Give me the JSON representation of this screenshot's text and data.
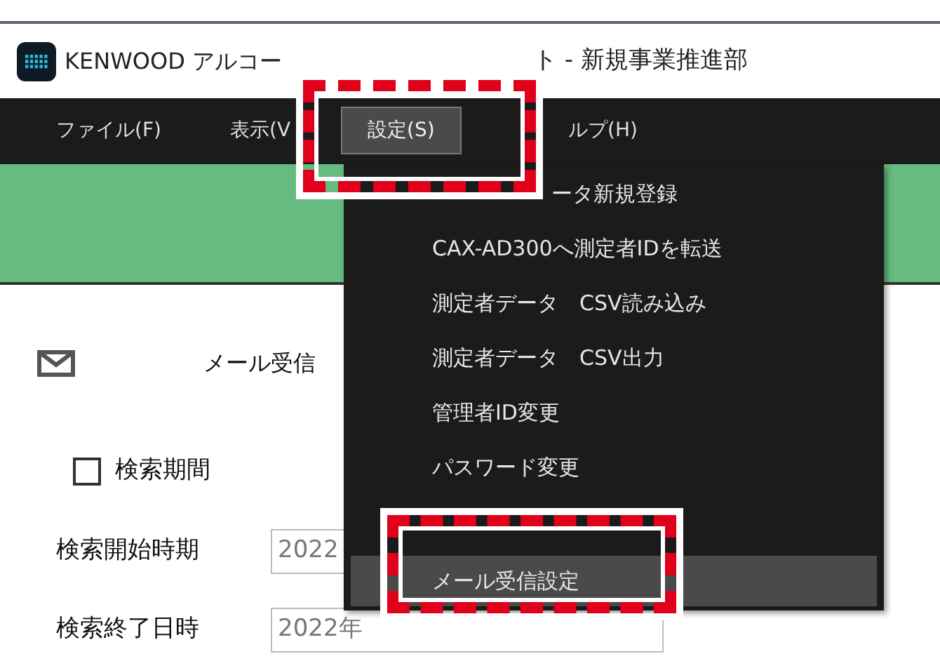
{
  "window": {
    "title_start": "KENWOOD アルコー",
    "title_end": "ト - 新規事業推進部"
  },
  "menu_bar": [
    {
      "label": "ファイル(F)",
      "selected": false
    },
    {
      "label": "表示(V",
      "selected": false
    },
    {
      "label": "設定(S)",
      "selected": true
    },
    {
      "label": "ルプ(H)",
      "selected": false
    }
  ],
  "dropdown": [
    {
      "label": "ータ新規登録",
      "selected": false
    },
    {
      "label": "CAX-AD300へ測定者IDを転送",
      "selected": false
    },
    {
      "label": "測定者データ　CSV読み込み",
      "selected": false
    },
    {
      "label": "測定者データ　CSV出力",
      "selected": false
    },
    {
      "label": "管理者ID変更",
      "selected": false
    },
    {
      "label": "パスワード変更",
      "selected": false
    },
    {
      "label": "メール受信設定",
      "selected": true
    }
  ],
  "mail": {
    "label": "メール受信"
  },
  "search_period": {
    "label": "検索期間",
    "checked": false
  },
  "fields": [
    {
      "label": "検索開始時期",
      "value": "2022"
    },
    {
      "label": "検索終了日時",
      "value": "2022年"
    }
  ]
}
